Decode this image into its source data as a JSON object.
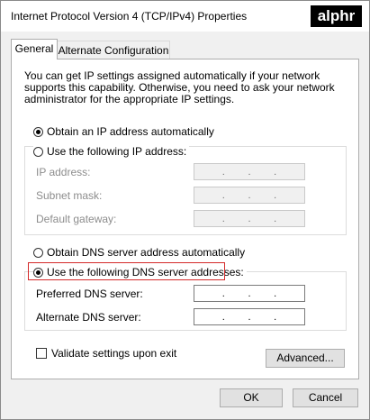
{
  "window": {
    "title": "Internet Protocol Version 4 (TCP/IPv4) Properties",
    "watermark": "alphr"
  },
  "tabs": [
    {
      "label": "General",
      "active": true
    },
    {
      "label": "Alternate Configuration",
      "active": false
    }
  ],
  "general": {
    "description": "You can get IP settings assigned automatically if your network supports this capability. Otherwise, you need to ask your network administrator for the appropriate IP settings.",
    "ip_mode": {
      "auto_label": "Obtain an IP address automatically",
      "manual_label": "Use the following IP address:",
      "selected": "auto"
    },
    "ip_fields": {
      "ip_address_label": "IP address:",
      "subnet_mask_label": "Subnet mask:",
      "default_gateway_label": "Default gateway:"
    },
    "dns_mode": {
      "auto_label": "Obtain DNS server address automatically",
      "manual_label": "Use the following DNS server addresses:",
      "selected": "manual"
    },
    "dns_fields": {
      "preferred_label": "Preferred DNS server:",
      "alternate_label": "Alternate DNS server:"
    },
    "ip_dot": ".",
    "validate_label": "Validate settings upon exit",
    "validate_checked": false,
    "advanced_button": "Advanced..."
  },
  "footer": {
    "ok_label": "OK",
    "cancel_label": "Cancel"
  },
  "colors": {
    "highlight_border": "#d42a2a",
    "disabled_text": "#8d8d8d"
  }
}
